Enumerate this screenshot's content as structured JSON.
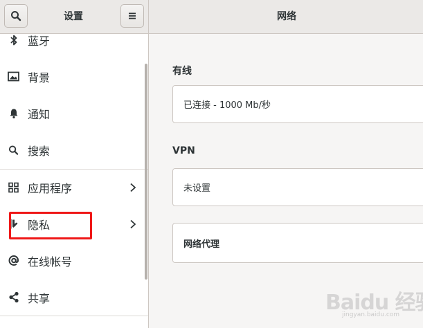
{
  "sidebar": {
    "title": "设置",
    "items": [
      {
        "label": "蓝牙",
        "icon": "bluetooth-icon"
      },
      {
        "label": "背景",
        "icon": "image-icon"
      },
      {
        "label": "通知",
        "icon": "bell-icon"
      },
      {
        "label": "搜索",
        "icon": "search-icon"
      },
      {
        "label": "应用程序",
        "icon": "apps-grid-icon"
      },
      {
        "label": "隐私",
        "icon": "privacy-icon"
      },
      {
        "label": "在线帐号",
        "icon": "at-sign-icon"
      },
      {
        "label": "共享",
        "icon": "share-icon"
      }
    ]
  },
  "main": {
    "title": "网络",
    "wired": {
      "label": "有线",
      "status": "已连接 - 1000 Mb/秒"
    },
    "vpn": {
      "label": "VPN",
      "status": "未设置"
    },
    "proxy": {
      "label": "网络代理"
    }
  },
  "annotation": {
    "color": "#ef1818"
  },
  "watermark": {
    "text": "Baidu 经验",
    "url": "jingyan.baidu.com"
  }
}
